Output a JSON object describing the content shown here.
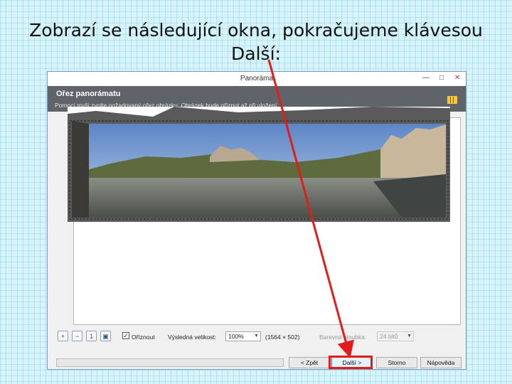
{
  "slide": {
    "title_line1": "Zobrazí se následující okna, pokračujeme klávesou",
    "title_line2": "Další:"
  },
  "window": {
    "title": "Panoráma",
    "minimize_icon": "minimize-icon",
    "maximize_icon": "maximize-icon",
    "close_icon": "close-icon"
  },
  "header": {
    "title": "Ořez panorámatu",
    "description": "Pomocí myši zvolte požadovaný ořez obrázku. Obrázek bude oříznut až při uložení."
  },
  "toolbar": {
    "crop_label": "Oříznout",
    "crop_checked": true,
    "result_size_label": "Výsledná velikost:",
    "zoom_value": "100%",
    "dimensions": "(1564 × 502)",
    "color_depth_label": "Barevná hloubka:",
    "color_depth_value": "24 bitů",
    "icons": [
      "zoom-in-icon",
      "zoom-out-icon",
      "actual-size-icon",
      "fit-window-icon"
    ]
  },
  "buttons": {
    "back": "< Zpět",
    "next": "Další >",
    "cancel": "Storno",
    "help": "Nápověda"
  },
  "colors": {
    "annotation": "#e41b1b",
    "header_band": "#5f6469",
    "slide_background": "#d8f4fa"
  }
}
